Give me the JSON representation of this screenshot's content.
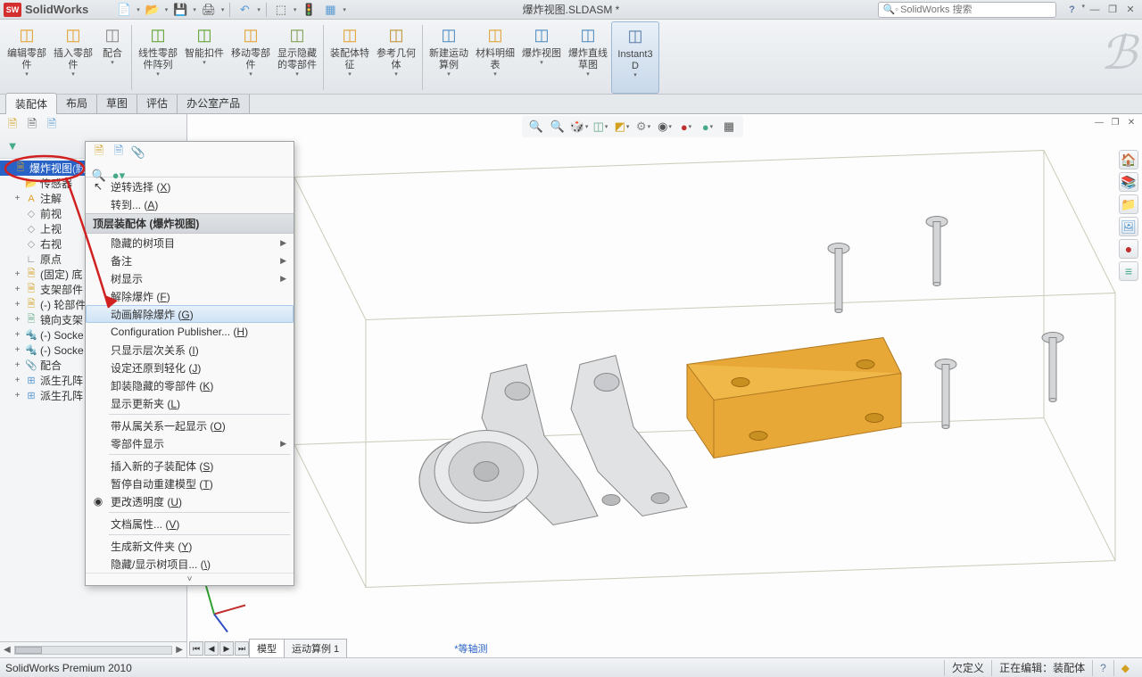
{
  "app": {
    "name": "SolidWorks",
    "logo": "SW"
  },
  "document_title": "爆炸视图.SLDASM *",
  "search": {
    "placeholder": "SolidWorks 搜索"
  },
  "ribbon": [
    {
      "label": "编辑零部件",
      "color": "#e0a030"
    },
    {
      "label": "插入零部件",
      "color": "#e0a030"
    },
    {
      "label": "配合",
      "color": "#888"
    },
    {
      "label": "线性零部件阵列",
      "color": "#5aa02a"
    },
    {
      "label": "智能扣件",
      "color": "#5aa02a"
    },
    {
      "label": "移动零部件",
      "color": "#e0a030"
    },
    {
      "label": "显示隐藏的零部件",
      "color": "#7a9c4a"
    },
    {
      "label": "装配体特征",
      "color": "#e0a030"
    },
    {
      "label": "参考几何体",
      "color": "#c09030"
    },
    {
      "label": "新建运动算例",
      "color": "#4a8ac0"
    },
    {
      "label": "材料明细表",
      "color": "#e0a030"
    },
    {
      "label": "爆炸视图",
      "color": "#4a8ac0"
    },
    {
      "label": "爆炸直线草图",
      "color": "#4a8ac0"
    },
    {
      "label": "Instant3D",
      "color": "#5a7ca5",
      "active": true
    }
  ],
  "tabs": [
    "装配体",
    "布局",
    "草图",
    "评估",
    "办公室产品"
  ],
  "active_tab": 0,
  "tree": {
    "root": "爆炸视图",
    "root_suffix": "(默认<默认_显示状态>",
    "items": [
      {
        "text": "传感器",
        "icon": "📂",
        "color": "#e0a030"
      },
      {
        "text": "注解",
        "icon": "A",
        "color": "#e0a030",
        "exp": "+"
      },
      {
        "text": "前视",
        "icon": "◇",
        "color": "#999"
      },
      {
        "text": "上视",
        "icon": "◇",
        "color": "#999"
      },
      {
        "text": "右视",
        "icon": "◇",
        "color": "#999"
      },
      {
        "text": "原点",
        "icon": "∟",
        "color": "#777"
      },
      {
        "text": "(固定) 底",
        "icon": "🗎",
        "color": "#d4a020",
        "exp": "+"
      },
      {
        "text": "支架部件",
        "icon": "🗎",
        "color": "#d4a020",
        "exp": "+"
      },
      {
        "text": "(-) 轮部件",
        "icon": "🗎",
        "color": "#d4a020",
        "exp": "+"
      },
      {
        "text": "镜向支架",
        "icon": "🗎",
        "color": "#6a8",
        "exp": "+"
      },
      {
        "text": "(-) Socke",
        "icon": "🔩",
        "color": "#888",
        "exp": "+"
      },
      {
        "text": "(-) Socke",
        "icon": "🔩",
        "color": "#888",
        "exp": "+"
      },
      {
        "text": "配合",
        "icon": "📎",
        "color": "#888",
        "exp": "+"
      },
      {
        "text": "派生孔阵",
        "icon": "⊞",
        "color": "#5a9ad4",
        "exp": "+"
      },
      {
        "text": "派生孔阵",
        "icon": "⊞",
        "color": "#5a9ad4",
        "exp": "+"
      }
    ]
  },
  "context_menu": {
    "first_group": [
      {
        "text": "逆转选择",
        "key": "X",
        "icon": "↖"
      },
      {
        "text": "转到...",
        "key": "A"
      }
    ],
    "header": "顶层装配体 (爆炸视图)",
    "items": [
      {
        "text": "隐藏的树项目",
        "sub": true
      },
      {
        "text": "备注",
        "sub": true
      },
      {
        "text": "树显示",
        "sub": true
      },
      {
        "text": "解除爆炸",
        "key": "F"
      },
      {
        "text": "动画解除爆炸",
        "key": "G",
        "hl": true
      },
      {
        "text": "Configuration Publisher...",
        "key": "H"
      },
      {
        "text": "只显示层次关系",
        "key": "I"
      },
      {
        "text": "设定还原到轻化",
        "key": "J"
      },
      {
        "text": "卸装隐藏的零部件",
        "key": "K"
      },
      {
        "text": "显示更新夹",
        "key": "L"
      }
    ],
    "group2": [
      {
        "text": "带从属关系一起显示",
        "key": "O"
      },
      {
        "text": "零部件显示",
        "sub": true
      }
    ],
    "group3": [
      {
        "text": "插入新的子装配体",
        "key": "S"
      },
      {
        "text": "暂停自动重建模型",
        "key": "T"
      },
      {
        "text": "更改透明度",
        "key": "U",
        "icon": "◉"
      }
    ],
    "group4": [
      {
        "text": "文档属性...",
        "key": "V"
      }
    ],
    "group5": [
      {
        "text": "生成新文件夹",
        "key": "Y"
      },
      {
        "text": "隐藏/显示树项目...",
        "key": "\\"
      }
    ]
  },
  "viewport_tabs": {
    "items": [
      "模型",
      "运动算例 1"
    ],
    "active": 0,
    "tag": "*等轴测"
  },
  "status": {
    "product": "SolidWorks Premium 2010",
    "center": "欠定义",
    "right": "正在编辑：装配体"
  }
}
